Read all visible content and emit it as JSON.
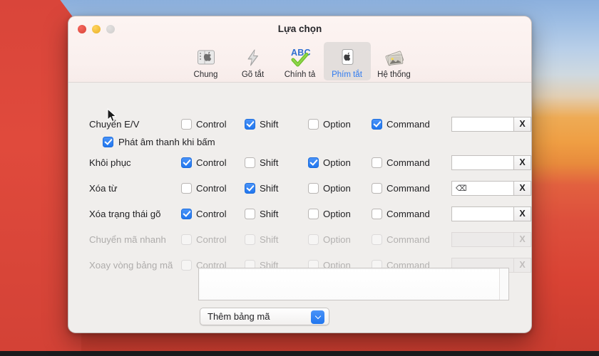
{
  "window": {
    "title": "Lựa chọn",
    "traffic_lights": [
      "close-red",
      "minimize-yellow",
      "zoom-gray"
    ]
  },
  "toolbar": {
    "items": [
      {
        "label": "Chung",
        "icon": "general-prefs-icon",
        "selected": false
      },
      {
        "label": "Gõ tắt",
        "icon": "lightning-bolt-icon",
        "selected": false
      },
      {
        "label": "Chính tả",
        "icon": "abc-spellcheck-icon",
        "selected": false
      },
      {
        "label": "Phím tắt",
        "icon": "keyboard-key-icon",
        "selected": true
      },
      {
        "label": "Hệ thống",
        "icon": "system-photos-icon",
        "selected": false
      }
    ],
    "selected_color": "#2f7bf0"
  },
  "modifier_columns": [
    "Control",
    "Shift",
    "Option",
    "Command"
  ],
  "shortcuts": [
    {
      "label": "Chuyển E/V",
      "control": false,
      "shift": true,
      "option": false,
      "command": true,
      "value": "",
      "clear_label": "X",
      "enabled": true
    },
    {
      "label": "Khôi phục",
      "control": true,
      "shift": false,
      "option": true,
      "command": false,
      "value": "",
      "clear_label": "X",
      "enabled": true
    },
    {
      "label": "Xóa từ",
      "control": false,
      "shift": true,
      "option": false,
      "command": false,
      "value": "⌫",
      "clear_label": "X",
      "enabled": true
    },
    {
      "label": "Xóa trạng thái gõ",
      "control": true,
      "shift": false,
      "option": false,
      "command": false,
      "value": "",
      "clear_label": "X",
      "enabled": true
    },
    {
      "label": "Chuyển mã nhanh",
      "control": false,
      "shift": false,
      "option": false,
      "command": false,
      "value": "",
      "clear_label": "X",
      "enabled": false
    },
    {
      "label": "Xoay vòng bảng mã",
      "control": false,
      "shift": false,
      "option": false,
      "command": false,
      "value": "",
      "clear_label": "X",
      "enabled": false
    }
  ],
  "sound_option": {
    "label": "Phát âm thanh khi bấm",
    "checked": true
  },
  "code_table_field": {
    "value": ""
  },
  "add_table_popup": {
    "label": "Thêm bảng mã"
  },
  "colors": {
    "accent": "#2176ee",
    "titlebar": "#faf0ee",
    "body": "#f0eeec"
  }
}
